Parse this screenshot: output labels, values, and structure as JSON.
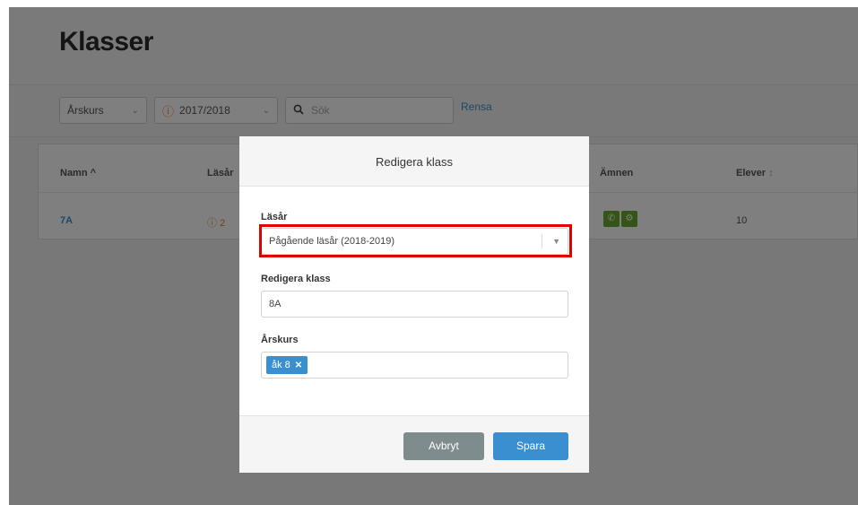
{
  "page": {
    "title": "Klasser"
  },
  "filters": {
    "grade_label": "Årskurs",
    "year_label": "2017/2018",
    "search_placeholder": "Sök",
    "clear_label": "Rensa"
  },
  "table": {
    "headers": {
      "name": "Namn",
      "name_sort": "^",
      "school_year": "Läsår",
      "subjects": "Ämnen",
      "students": "Elever",
      "students_sort": "↕"
    },
    "rows": [
      {
        "name": "7A",
        "year_partial": "2",
        "students": "10"
      }
    ]
  },
  "modal": {
    "title": "Redigera klass",
    "year_label": "Läsår",
    "year_value": "Pågående läsår (2018-2019)",
    "class_label": "Redigera klass",
    "class_value": "8A",
    "grade_label": "Årskurs",
    "grade_tag": "åk 8",
    "cancel_label": "Avbryt",
    "save_label": "Spara"
  },
  "colors": {
    "accent": "#3a8fd0",
    "highlight": "#e00000",
    "warning": "#e5822a",
    "subject": "#6aa92f"
  }
}
